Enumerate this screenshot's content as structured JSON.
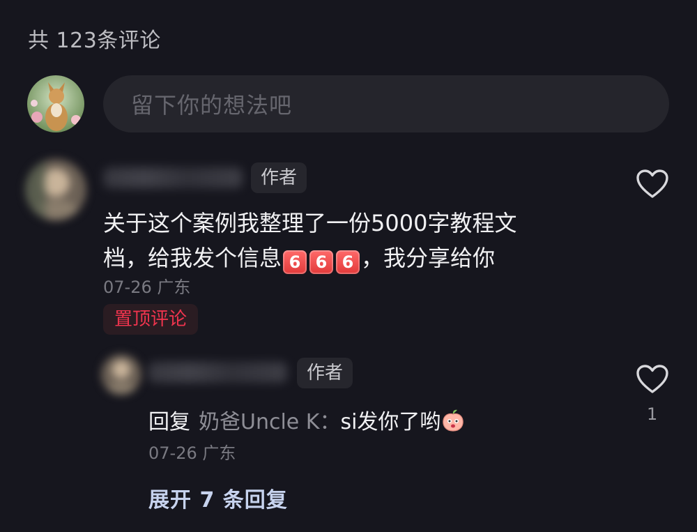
{
  "header": {
    "count_title": "共 123条评论"
  },
  "composer": {
    "placeholder": "留下你的想法吧"
  },
  "comment": {
    "author_badge": "作者",
    "text_line1": "关于这个案例我整理了一份5000字教程文",
    "text_line2_before": "档，给我发个信息",
    "number_emojis": [
      "6",
      "6",
      "6"
    ],
    "text_line2_after": "，我分享给你",
    "meta": "07-26 广东",
    "pinned_label": "置顶评论"
  },
  "reply": {
    "author_badge": "作者",
    "prefix": "回复",
    "mention": "奶爸Uncle K：",
    "text": "si发你了哟",
    "emoji": "peach-face-emoji",
    "meta": "07-26 广东",
    "like_count": "1"
  },
  "expand": {
    "label": "展开 7 条回复"
  },
  "icons": {
    "like": "heart-outline-icon"
  },
  "colors": {
    "background": "#16161e",
    "pinned": "#f0344e",
    "link": "#c7d3ee"
  }
}
